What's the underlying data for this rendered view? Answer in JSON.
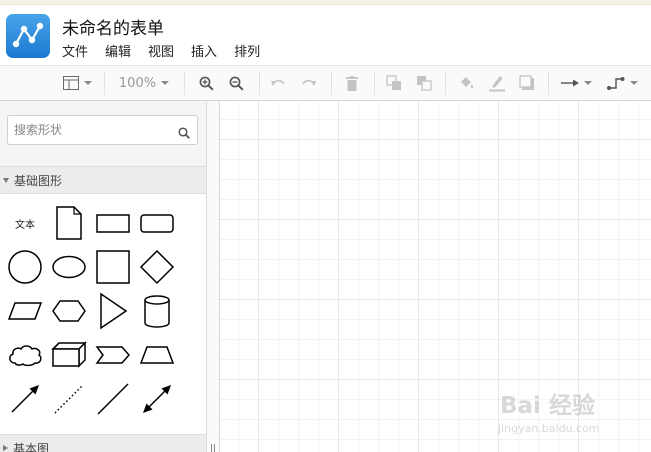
{
  "app": {
    "title": "未命名的表单",
    "menu": [
      "文件",
      "编辑",
      "视图",
      "插入",
      "排列"
    ]
  },
  "toolbar": {
    "zoom": "100%",
    "buttons": [
      "format-panel",
      "zoom-in",
      "zoom-out",
      "undo",
      "redo",
      "delete",
      "to-front",
      "to-back",
      "fill-color",
      "line-color",
      "shadow",
      "connection-style",
      "waypoints"
    ]
  },
  "sidebar": {
    "search_placeholder": "搜索形状",
    "sections": [
      {
        "label": "基础图形",
        "expanded": true
      },
      {
        "label": "基本图",
        "expanded": false
      }
    ],
    "text_shape_label": "文本"
  },
  "watermark": {
    "brand": "Bai 经验",
    "url": "jingyan.baidu.com"
  },
  "colors": {
    "accent": "#2a8be0",
    "toolbar_icon": "#6b6b6b",
    "toolbar_icon_disabled": "#c4c4c4",
    "sidebar_bg": "#f5f5f5"
  }
}
